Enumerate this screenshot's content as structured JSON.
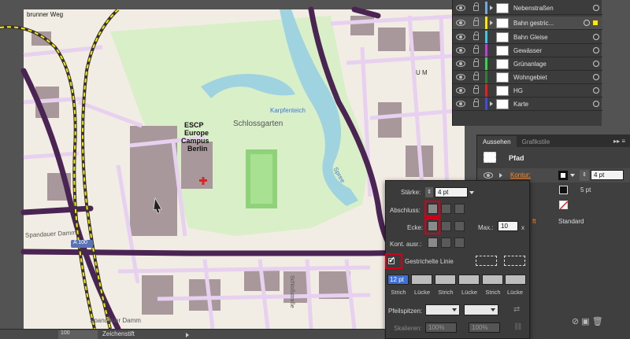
{
  "map": {
    "labels": {
      "street_top_left": "brunner Weg",
      "escp_line1": "ESCP",
      "escp_line2": "Europe",
      "escp_line3": "Campus",
      "escp_line4": "Berlin",
      "schlossgarten": "Schlossgarten",
      "karpfenteich": "Karpfenteich",
      "spandauer_damm_left": "Spandauer Damm",
      "spandauer_damm_bottom": "Spandauer Damm",
      "spree": "Spree",
      "u_mierendorff": "U M",
      "schlossstrasse": "Schloßstraße",
      "road_sign": "A 100"
    }
  },
  "layers": {
    "rows": [
      {
        "name": "Nebenstraßen",
        "color": "#6fa8dc",
        "expandable": true,
        "selected": false
      },
      {
        "name": "Bahn gestric...",
        "color": "#ffe700",
        "expandable": true,
        "selected": true
      },
      {
        "name": "Bahn Gleise",
        "color": "#3cc6e0",
        "expandable": false,
        "selected": false
      },
      {
        "name": "Gewässer",
        "color": "#c43cd6",
        "expandable": false,
        "selected": false
      },
      {
        "name": "Grünanlage",
        "color": "#2fd94b",
        "expandable": false,
        "selected": false
      },
      {
        "name": "Wohngebiet",
        "color": "#2e7d3a",
        "expandable": false,
        "selected": false
      },
      {
        "name": "HG",
        "color": "#e02222",
        "expandable": false,
        "selected": false
      },
      {
        "name": "Karte",
        "color": "#3d4fd6",
        "expandable": true,
        "selected": false
      }
    ]
  },
  "appearance": {
    "tabs": [
      "Aussehen",
      "Grafikstile"
    ],
    "title": "Pfad",
    "stroke_label": "Kontur:",
    "stroke_weight": "4 pt",
    "stroke_weight_2": "5 pt",
    "opacity": "Standard",
    "fill_label_partial": "ft"
  },
  "stroke_panel": {
    "weight_label": "Stärke:",
    "weight_value": "4 pt",
    "cap_label": "Abschluss:",
    "corner_label": "Ecke:",
    "limit_label": "Max.:",
    "limit_value": "10",
    "limit_unit": "x",
    "align_label": "Kont. ausr.:",
    "dashed_label": "Gestrichelte Linie",
    "dashed_checked": true,
    "dash_values": [
      "12 pt",
      "",
      "",
      "",
      "",
      ""
    ],
    "dash_labels": [
      "Strich",
      "Lücke",
      "Strich",
      "Lücke",
      "Strich",
      "Lücke"
    ],
    "arrow_label": "Pfeilspitzen:",
    "scale_label": "Skalieren:",
    "scale_1": "100%",
    "scale_2": "100%"
  },
  "status": {
    "zoom": "100",
    "tool": "Zeichenstift"
  },
  "colors": {
    "map_background": "#f2ede4",
    "park": "#d9efc8",
    "water": "#9fd3e0",
    "road": "#4a2452",
    "street": "#e7d0f0",
    "building": "#a8989b",
    "highlight": "#d0021b"
  }
}
